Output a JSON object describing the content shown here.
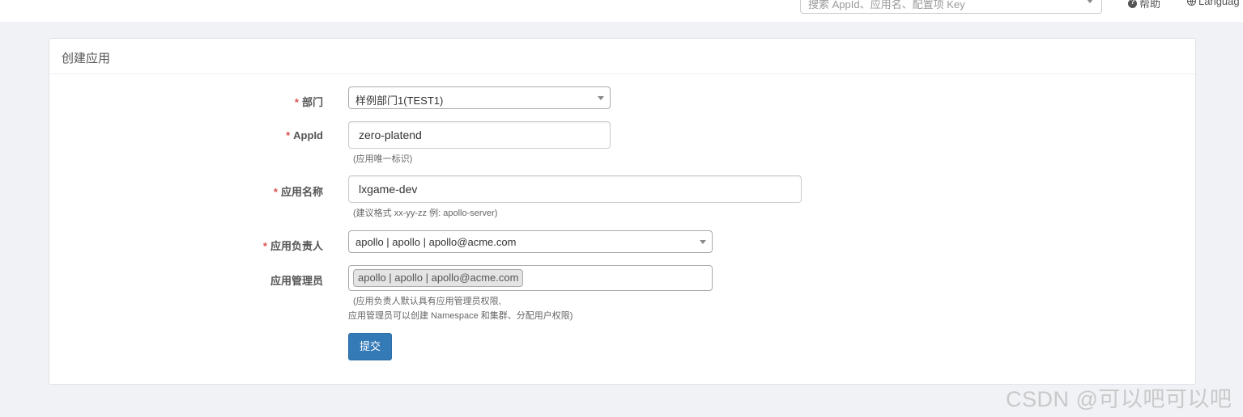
{
  "header": {
    "search_placeholder": "搜索 AppId、应用名、配置项 Key",
    "help_label": "帮助",
    "language_label": "Languag"
  },
  "panel": {
    "title": "创建应用"
  },
  "form": {
    "department": {
      "label": "部门",
      "required": "*",
      "value": "样例部门1(TEST1)"
    },
    "app_id": {
      "label": "AppId",
      "required": "*",
      "value": "zero-platend",
      "hint": "(应用唯一标识)"
    },
    "app_name": {
      "label": "应用名称",
      "required": "*",
      "value": "lxgame-dev",
      "hint": "(建议格式 xx-yy-zz 例: apollo-server)"
    },
    "owner": {
      "label": "应用负责人",
      "required": "*",
      "value": "apollo | apollo | apollo@acme.com"
    },
    "admins": {
      "label": "应用管理员",
      "tags": [
        "apollo | apollo | apollo@acme.com"
      ],
      "hint_line1": "(应用负责人默认具有应用管理员权限,",
      "hint_line2": "应用管理员可以创建 Namespace 和集群、分配用户权限)"
    },
    "submit_label": "提交"
  },
  "watermark": "CSDN @可以吧可以吧",
  "colors": {
    "primary": "#337ab7",
    "required": "#d9534f",
    "page_bg": "#f1f2f6"
  }
}
